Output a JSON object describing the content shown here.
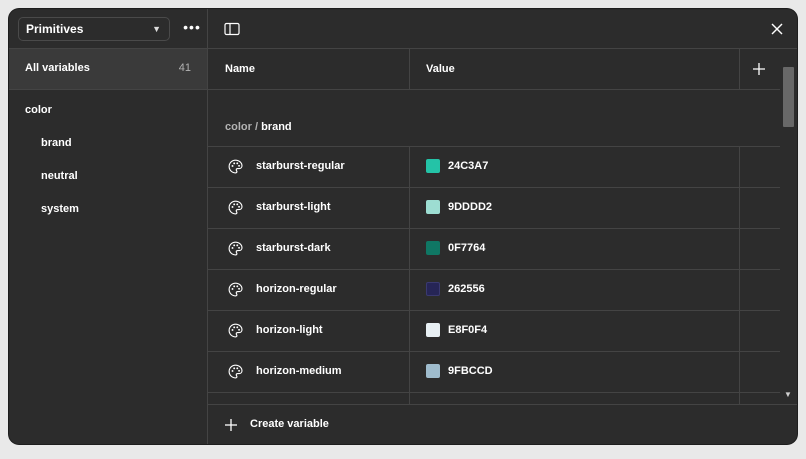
{
  "sidebar": {
    "collection": "Primitives",
    "all_variables": {
      "label": "All variables",
      "count": "41"
    },
    "groups": [
      {
        "label": "color",
        "level": "root"
      },
      {
        "label": "brand",
        "level": "child"
      },
      {
        "label": "neutral",
        "level": "child"
      },
      {
        "label": "system",
        "level": "child"
      }
    ]
  },
  "table": {
    "columns": {
      "name": "Name",
      "value": "Value"
    },
    "group_path": {
      "parent": "color",
      "separator": " / ",
      "current": "brand"
    },
    "rows": [
      {
        "name": "starburst-regular",
        "value": "24C3A7",
        "color": "#24C3A7"
      },
      {
        "name": "starburst-light",
        "value": "9DDDD2",
        "color": "#9DDDD2"
      },
      {
        "name": "starburst-dark",
        "value": "0F7764",
        "color": "#0F7764"
      },
      {
        "name": "horizon-regular",
        "value": "262556",
        "color": "#262556"
      },
      {
        "name": "horizon-light",
        "value": "E8F0F4",
        "color": "#E8F0F4"
      },
      {
        "name": "horizon-medium",
        "value": "9FBCCD",
        "color": "#9FBCCD"
      }
    ]
  },
  "footer": {
    "create_label": "Create variable"
  },
  "icons": {
    "collection_chevron": "chevron-down-icon",
    "more": "more-horizontal-icon",
    "sidebar_toggle": "sidebar-toggle-icon",
    "close": "close-icon",
    "add_column": "plus-icon",
    "variable_type": "palette-icon",
    "create": "plus-icon"
  }
}
